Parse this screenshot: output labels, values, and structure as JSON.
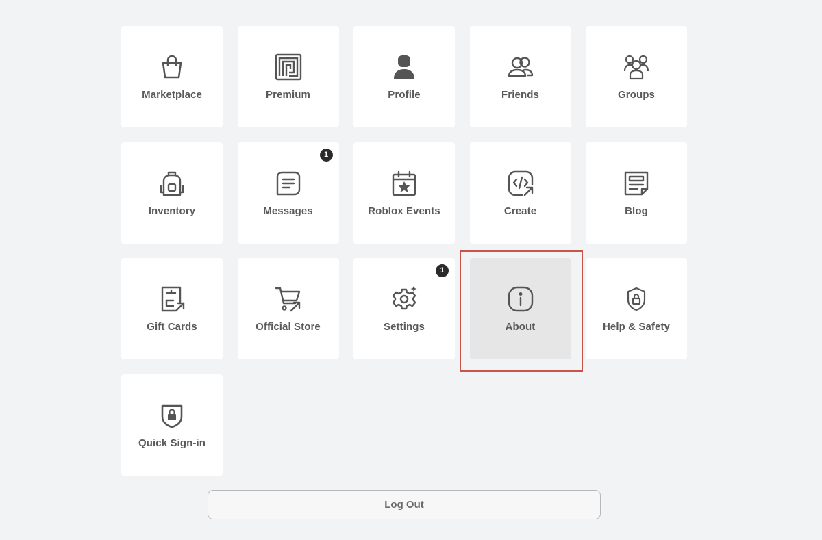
{
  "menu": {
    "tiles": [
      {
        "label": "Marketplace",
        "icon": "shopping-bag-icon"
      },
      {
        "label": "Premium",
        "icon": "premium-icon"
      },
      {
        "label": "Profile",
        "icon": "profile-icon"
      },
      {
        "label": "Friends",
        "icon": "friends-icon"
      },
      {
        "label": "Groups",
        "icon": "groups-icon"
      },
      {
        "label": "Inventory",
        "icon": "backpack-icon"
      },
      {
        "label": "Messages",
        "icon": "message-icon",
        "badge": "1"
      },
      {
        "label": "Roblox Events",
        "icon": "calendar-star-icon"
      },
      {
        "label": "Create",
        "icon": "code-icon"
      },
      {
        "label": "Blog",
        "icon": "blog-icon"
      },
      {
        "label": "Gift Cards",
        "icon": "gift-card-icon"
      },
      {
        "label": "Official Store",
        "icon": "cart-icon"
      },
      {
        "label": "Settings",
        "icon": "gear-icon",
        "badge": "1"
      },
      {
        "label": "About",
        "icon": "info-icon",
        "active": true
      },
      {
        "label": "Help & Safety",
        "icon": "shield-lock-icon"
      },
      {
        "label": "Quick Sign-in",
        "icon": "quick-signin-shield-icon"
      }
    ]
  },
  "logout": {
    "label": "Log Out"
  },
  "colors": {
    "background": "#f2f3f5",
    "tile": "#ffffff",
    "tile_active": "#e6e6e6",
    "text": "#5a5a5a",
    "badge": "#2b2b2b",
    "highlight": "#c9544a"
  }
}
